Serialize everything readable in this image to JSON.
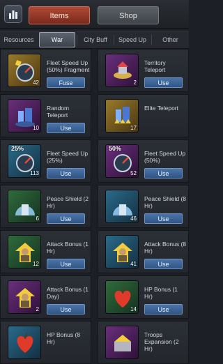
{
  "main_tabs": {
    "items": "Items",
    "shop": "Shop"
  },
  "sub_tabs": [
    "Resources",
    "War",
    "City Buff",
    "Speed Up",
    "Other"
  ],
  "colors": {
    "accent_red": "#b04a36",
    "button_blue": "#3f66a0"
  },
  "cards": [
    {
      "name": "Fleet Speed Up (50%) Fragment",
      "count": "42",
      "button": "Fuse",
      "icon": "speedometer-fragment-icon",
      "frame": "gold"
    },
    {
      "name": "Territory Teleport",
      "count": "2",
      "button": "Use",
      "icon": "territory-teleport-icon",
      "frame": "purple"
    },
    {
      "name": "Random Teleport",
      "count": "10",
      "button": "Use",
      "icon": "random-teleport-icon",
      "frame": "purple"
    },
    {
      "name": "Elite Teleport",
      "count": "17",
      "button": "",
      "icon": "elite-teleport-icon",
      "frame": "gold"
    },
    {
      "name": "Fleet Speed Up (25%)",
      "count": "113",
      "button": "Use",
      "icon": "speedometer-icon",
      "frame": "blue",
      "pct": "25%"
    },
    {
      "name": "Fleet Speed Up (50%)",
      "count": "52",
      "button": "Use",
      "icon": "speedometer-icon",
      "frame": "purple",
      "pct": "50%"
    },
    {
      "name": "Peace Shield (2 Hr)",
      "count": "6",
      "button": "Use",
      "icon": "shield-dome-icon",
      "frame": "green"
    },
    {
      "name": "Peace Shield (8 Hr)",
      "count": "46",
      "button": "Use",
      "icon": "shield-dome-icon",
      "frame": "blue"
    },
    {
      "name": "Attack Bonus (1 Hr)",
      "count": "12",
      "button": "Use",
      "icon": "soldier-icon",
      "frame": "green"
    },
    {
      "name": "Attack Bonus (8 Hr)",
      "count": "41",
      "button": "Use",
      "icon": "soldier-icon",
      "frame": "blue"
    },
    {
      "name": "Attack Bonus (1 Day)",
      "count": "2",
      "button": "Use",
      "icon": "soldier-icon",
      "frame": "purple"
    },
    {
      "name": "HP Bonus (1 Hr)",
      "count": "14",
      "button": "Use",
      "icon": "heart-apple-icon",
      "frame": "green"
    },
    {
      "name": "HP Bonus (8 Hr)",
      "count": "",
      "button": "",
      "icon": "heart-apple-icon",
      "frame": "blue"
    },
    {
      "name": "Troops Expansion (2 Hr)",
      "count": "",
      "button": "",
      "icon": "troops-expansion-icon",
      "frame": "purple"
    }
  ]
}
